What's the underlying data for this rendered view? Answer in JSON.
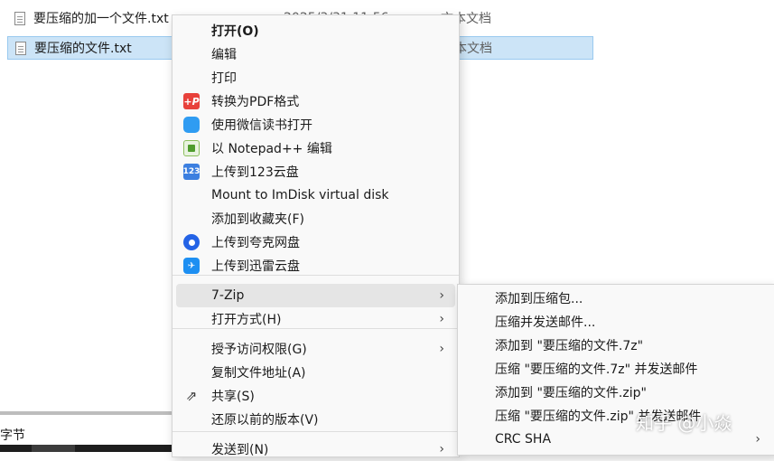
{
  "files": [
    {
      "name": "要压缩的加一个文件.txt",
      "date": "2025/3/31 11:56",
      "type": "文本文档",
      "selected": false
    },
    {
      "name": "要压缩的文件.txt",
      "date": "",
      "type": "文本文档",
      "selected": true
    }
  ],
  "status": {
    "size_text": "字节"
  },
  "context_menu": {
    "items": [
      {
        "label": "打开(O)",
        "icon": "none",
        "bold": true
      },
      {
        "label": "编辑",
        "icon": "none"
      },
      {
        "label": "打印",
        "icon": "none"
      },
      {
        "label": "转换为PDF格式",
        "icon": "pdf-convert-icon",
        "glyph": "+P"
      },
      {
        "label": "使用微信读书打开",
        "icon": "wechat-read-icon",
        "glyph": ""
      },
      {
        "label": "以 Notepad++ 编辑",
        "icon": "notepad-plus-icon",
        "glyph": ""
      },
      {
        "label": "上传到123云盘",
        "icon": "cloud-123-icon",
        "glyph": "123"
      },
      {
        "label": "Mount to ImDisk virtual disk",
        "icon": "none"
      },
      {
        "label": "添加到收藏夹(F)",
        "icon": "none"
      },
      {
        "label": "上传到夸克网盘",
        "icon": "quark-icon",
        "glyph": ""
      },
      {
        "label": "上传到迅雷云盘",
        "icon": "xunlei-icon",
        "glyph": "✈"
      },
      {
        "label": "7-Zip",
        "icon": "none",
        "submenu": true,
        "hover": true
      },
      {
        "label": "打开方式(H)",
        "icon": "none",
        "submenu": true
      },
      {
        "label": "授予访问权限(G)",
        "icon": "none",
        "submenu": true
      },
      {
        "label": "复制文件地址(A)",
        "icon": "none"
      },
      {
        "label": "共享(S)",
        "icon": "share-icon",
        "glyph": "⇗"
      },
      {
        "label": "还原以前的版本(V)",
        "icon": "none"
      },
      {
        "label": "发送到(N)",
        "icon": "none",
        "submenu": true
      }
    ]
  },
  "zip_submenu": {
    "items": [
      {
        "label": "添加到压缩包..."
      },
      {
        "label": "压缩并发送邮件..."
      },
      {
        "label": "添加到 \"要压缩的文件.7z\""
      },
      {
        "label": "压缩 \"要压缩的文件.7z\" 并发送邮件"
      },
      {
        "label": "添加到 \"要压缩的文件.zip\""
      },
      {
        "label": "压缩 \"要压缩的文件.zip\" 并发送邮件"
      },
      {
        "label": "CRC SHA",
        "submenu": true
      }
    ]
  },
  "watermark": "知乎 @小焱",
  "chevron": "›"
}
